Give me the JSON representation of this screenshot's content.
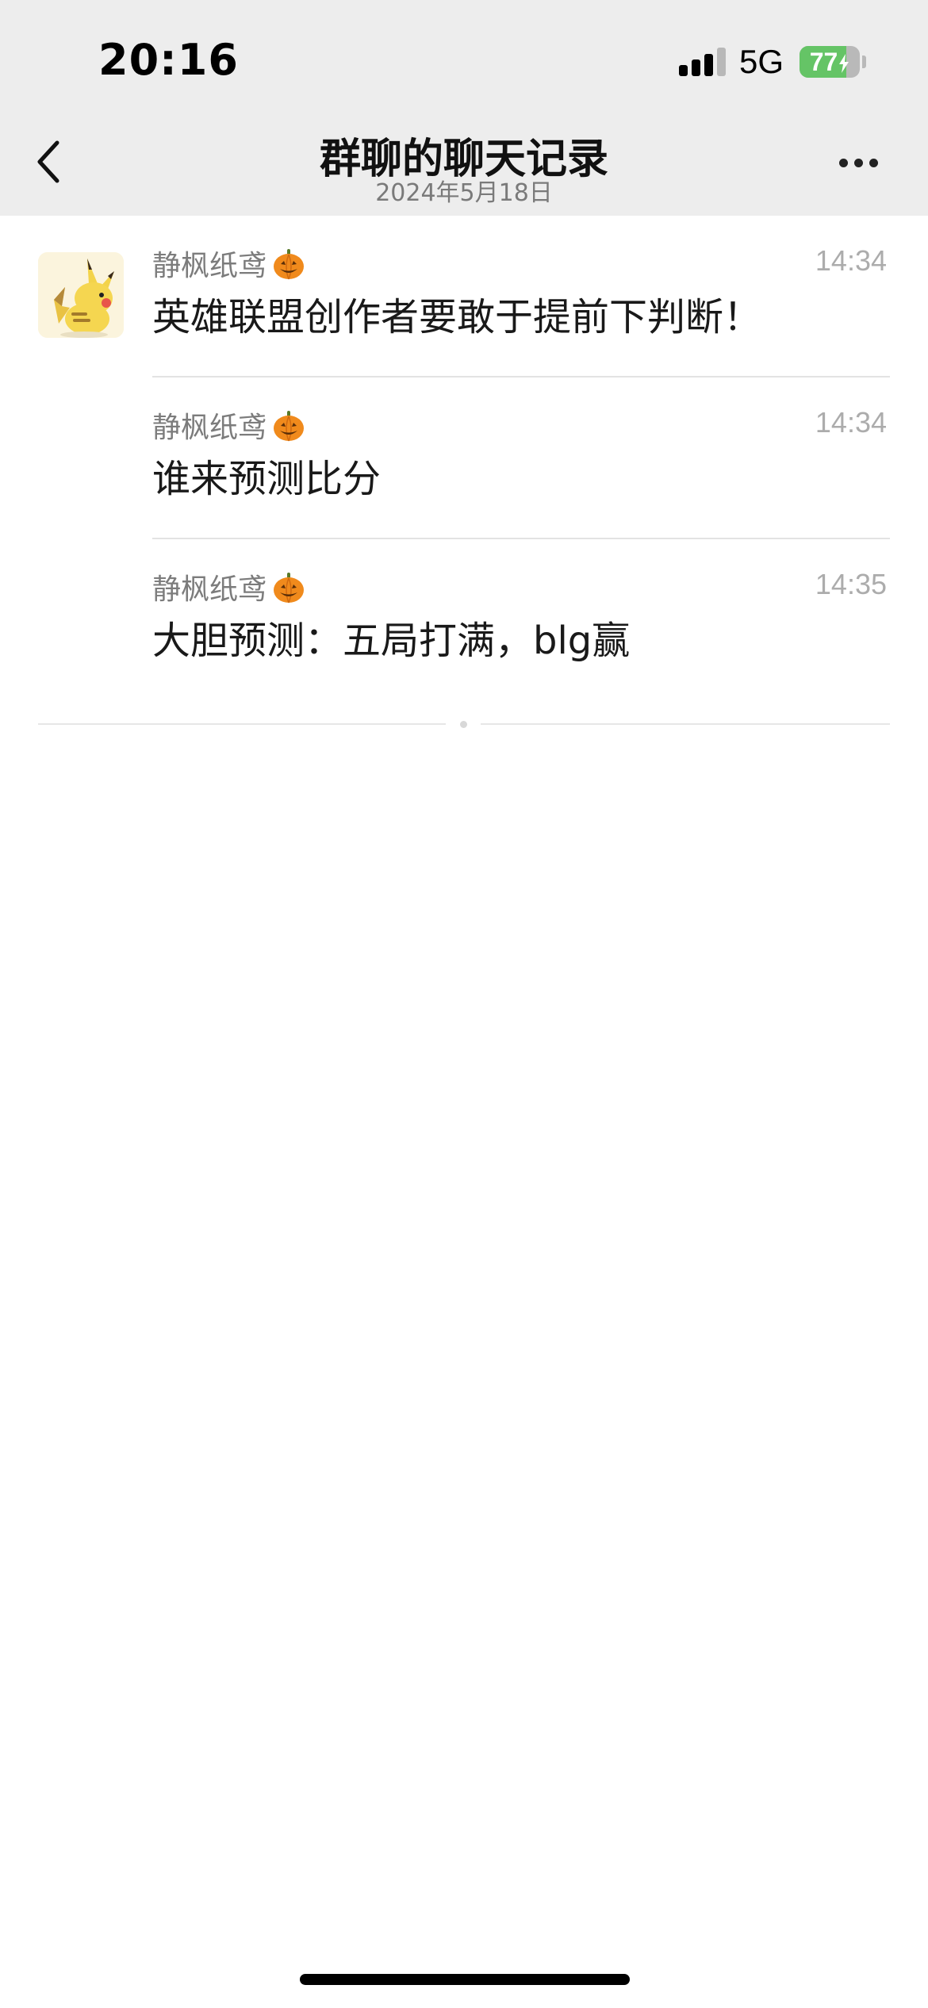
{
  "status_bar": {
    "time": "20:16",
    "network": "5G",
    "battery_level": "77",
    "battery_fraction": 0.77,
    "battery_color": "#65c466"
  },
  "nav": {
    "title": "群聊的聊天记录",
    "subtitle": "2024年5月18日",
    "back_icon": "chevron-left-icon",
    "more_icon": "ellipsis-icon"
  },
  "messages": [
    {
      "sender": "静枫纸鸢",
      "sender_emoji": "jack-o-lantern",
      "time": "14:34",
      "text": "英雄联盟创作者要敢于提前下判断！",
      "avatar": "pikachu-avatar"
    },
    {
      "sender": "静枫纸鸢",
      "sender_emoji": "jack-o-lantern",
      "time": "14:34",
      "text": "谁来预测比分"
    },
    {
      "sender": "静枫纸鸢",
      "sender_emoji": "jack-o-lantern",
      "time": "14:35",
      "text": "大胆预测：五局打满，blg赢"
    }
  ]
}
